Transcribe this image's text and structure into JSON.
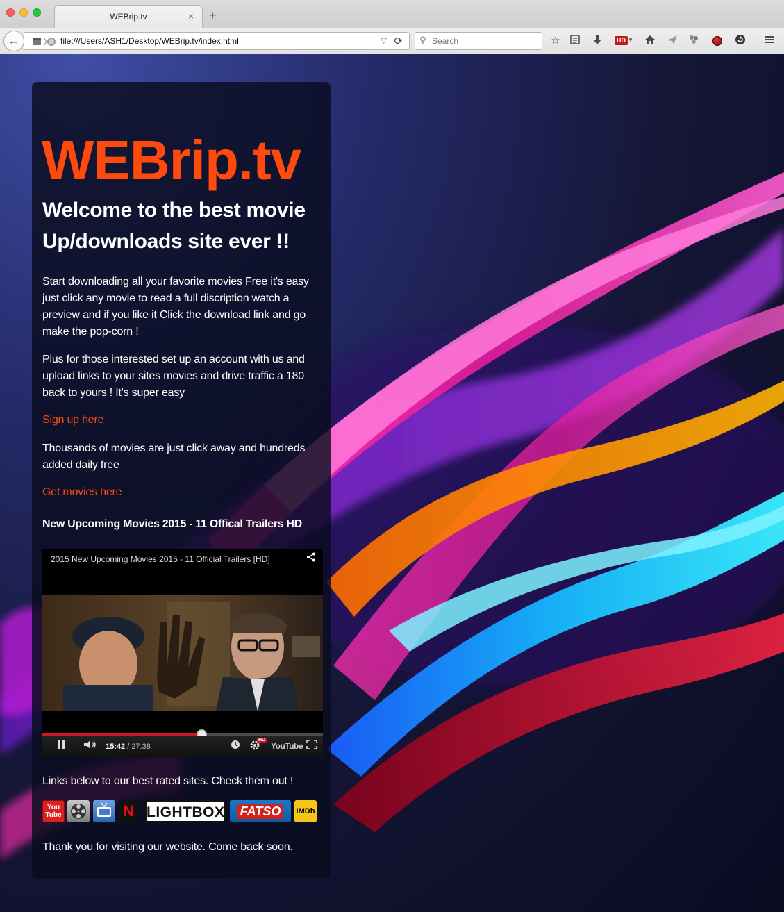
{
  "browser": {
    "tab_title": "WEBrip.tv",
    "tab_close": "×",
    "new_tab": "+",
    "url": "file:///Users/ASH1/Desktop/WEBrip.tv/index.html",
    "search_placeholder": "Search",
    "back_glyph": "←",
    "reload_glyph": "⟳",
    "hd_badge": "HD",
    "toolbar_icons": [
      "bookmark-star-icon",
      "reading-list-icon",
      "download-icon",
      "hd-video-icon",
      "home-icon",
      "send-icon",
      "extension-icon",
      "record-icon",
      "sync-icon",
      "menu-icon"
    ]
  },
  "content": {
    "site_title": "WEBrip.tv",
    "welcome": "Welcome to the best movie Up/downloads site ever !!",
    "intro": "Start downloading all your favorite movies Free it's easy just click any movie to read a full discription watch a preview and if you like it Click the download link and go make the pop-corn !",
    "account_pitch": "Plus for those interested set up an account with us and upload links to your sites movies and drive traffic a 180 back to yours ! It's super easy",
    "signup_link": "Sign up here",
    "thousands": "Thousands of movies are just click away and hundreds added daily free",
    "movies_link": "Get movies here",
    "trailer_heading": "New Upcoming Movies 2015 - 11 Offical Trailers HD",
    "links_intro": "Links below to our best rated sites. Check them out !",
    "thanks": "Thank you for visiting our website. Come back soon."
  },
  "video": {
    "title": "2015 New Upcoming Movies 2015 - 11 Official Trailers [HD]",
    "current_time": "15:42",
    "duration": "27:38",
    "progress_fraction": 0.568,
    "hd_label": "HD",
    "youtube_label": "YouTube"
  },
  "logos": {
    "youtube": "You Tube",
    "netflix": "N",
    "lightbox": "LIGHTBOX",
    "fatso": "FATSO",
    "imdb": "IMDb"
  },
  "colors": {
    "accent_orange": "#ff4a0d",
    "panel": "#0a0c1e",
    "youtube_red": "#cc181e"
  }
}
